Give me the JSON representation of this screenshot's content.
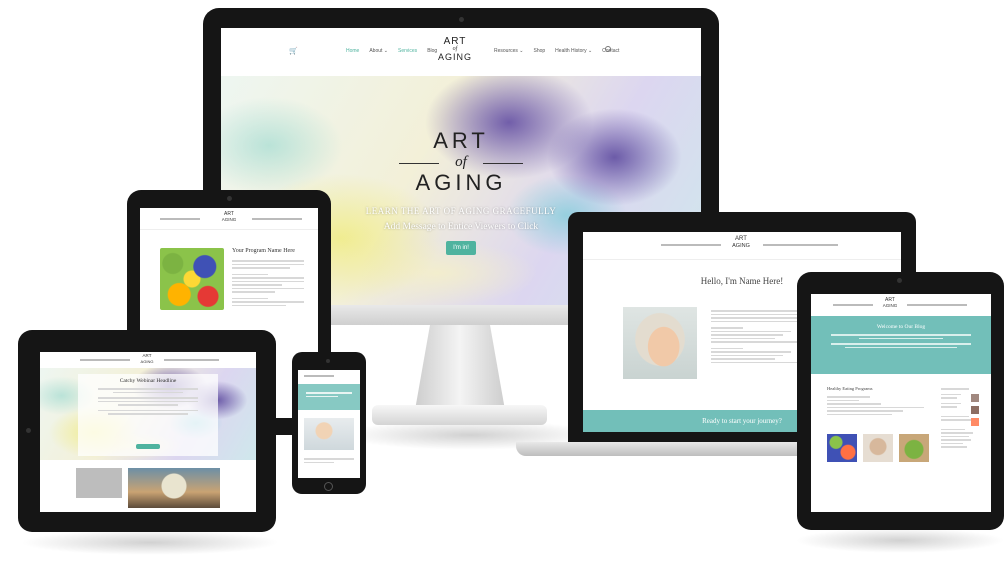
{
  "desktop": {
    "logo_top": "ART",
    "logo_mid": "of",
    "logo_bottom": "AGING",
    "nav_left": [
      "Home",
      "About ⌄",
      "Services",
      "Blog"
    ],
    "nav_right": [
      "Resources ⌄",
      "Shop",
      "Health History ⌄",
      "Contact"
    ],
    "hero_title_top": "ART",
    "hero_title_mid": "of",
    "hero_title_bottom": "AGING",
    "hero_tagline": "LEARN THE ART OF AGING GRACEFULLY",
    "hero_message": "Add Message to Entice Viewers to Click",
    "hero_button": "I'm in!"
  },
  "tablet_left": {
    "logo_top": "ART",
    "logo_bottom": "AGING",
    "program_title": "Your Program Name Here"
  },
  "tablet_bottom": {
    "logo_top": "ART",
    "logo_bottom": "AGING",
    "headline": "Catchy Webinar Headline"
  },
  "laptop": {
    "logo_top": "ART",
    "logo_bottom": "AGING",
    "greeting": "Hello, I'm Name Here!",
    "banner_text": "Ready to start your journey?"
  },
  "tablet_right": {
    "logo_top": "ART",
    "logo_bottom": "AGING",
    "welcome": "Welcome to Our Blog",
    "section_title": "Healthy Eating Programs"
  },
  "colors": {
    "accent": "#4fb39f",
    "banner": "#72bfb9",
    "bezel": "#151515"
  }
}
